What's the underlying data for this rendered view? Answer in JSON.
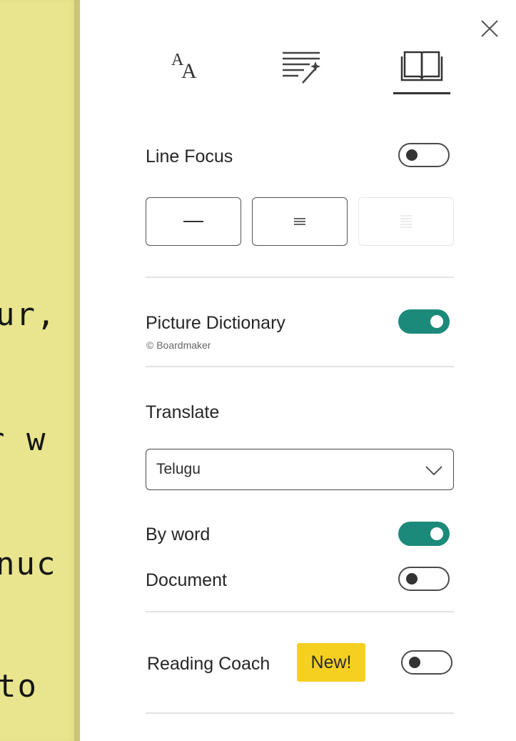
{
  "document": {
    "lines": [
      "ur,",
      "r w",
      "nuc",
      "to"
    ]
  },
  "tabs": [
    {
      "icon": "text-size-icon",
      "label": "AA"
    },
    {
      "icon": "grammar-options-icon"
    },
    {
      "icon": "reading-preferences-icon",
      "active": true
    }
  ],
  "line_focus": {
    "label": "Line Focus",
    "enabled": false,
    "options": [
      "one-line",
      "three-lines",
      "five-lines"
    ]
  },
  "picture_dictionary": {
    "label": "Picture Dictionary",
    "credit": "© Boardmaker",
    "enabled": true
  },
  "translate": {
    "label": "Translate",
    "language": "Telugu",
    "by_word_label": "By word",
    "by_word_enabled": true,
    "document_label": "Document",
    "document_enabled": false
  },
  "reading_coach": {
    "label": "Reading Coach",
    "badge": "New!",
    "enabled": false
  },
  "colors": {
    "accent": "#1c8a7a",
    "badge": "#f6d021",
    "document_background": "#e8e58e"
  }
}
